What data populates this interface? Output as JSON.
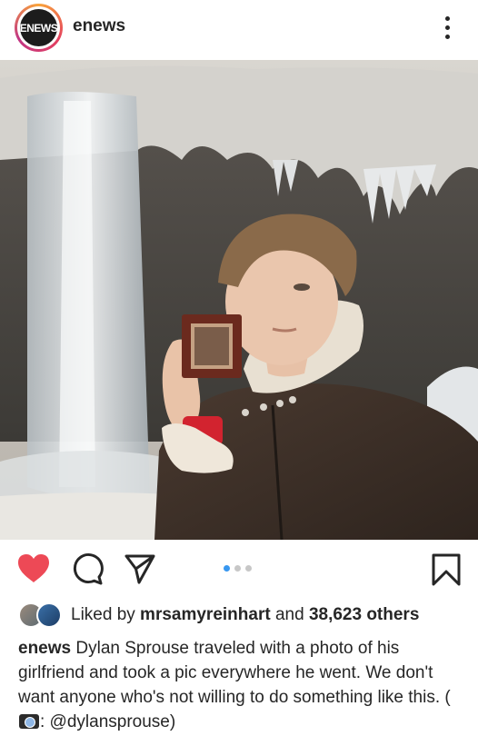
{
  "header": {
    "avatar_text": "ENEWS",
    "username": "enews",
    "more_icon": "more-vertical-icon"
  },
  "post": {
    "image_alt": "Dylan Sprouse holding a framed photo in front of a frozen waterfall",
    "carousel": {
      "count": 3,
      "active": 1
    }
  },
  "actions": {
    "like_icon": "heart-icon",
    "comment_icon": "comment-icon",
    "share_icon": "send-icon",
    "save_icon": "bookmark-icon",
    "like_color": "#ed4956"
  },
  "likes": {
    "prefix": "Liked by ",
    "user": "mrsamyreinhart",
    "middle": " and ",
    "others": "38,623 others"
  },
  "caption": {
    "author": "enews",
    "text_before": " Dylan Sprouse traveled with a photo of his girlfriend and took a pic everywhere he went. We don't want anyone who's not willing to do something like this. (",
    "text_after": ": @dylansprouse)",
    "inline_icon": "camera-icon"
  }
}
